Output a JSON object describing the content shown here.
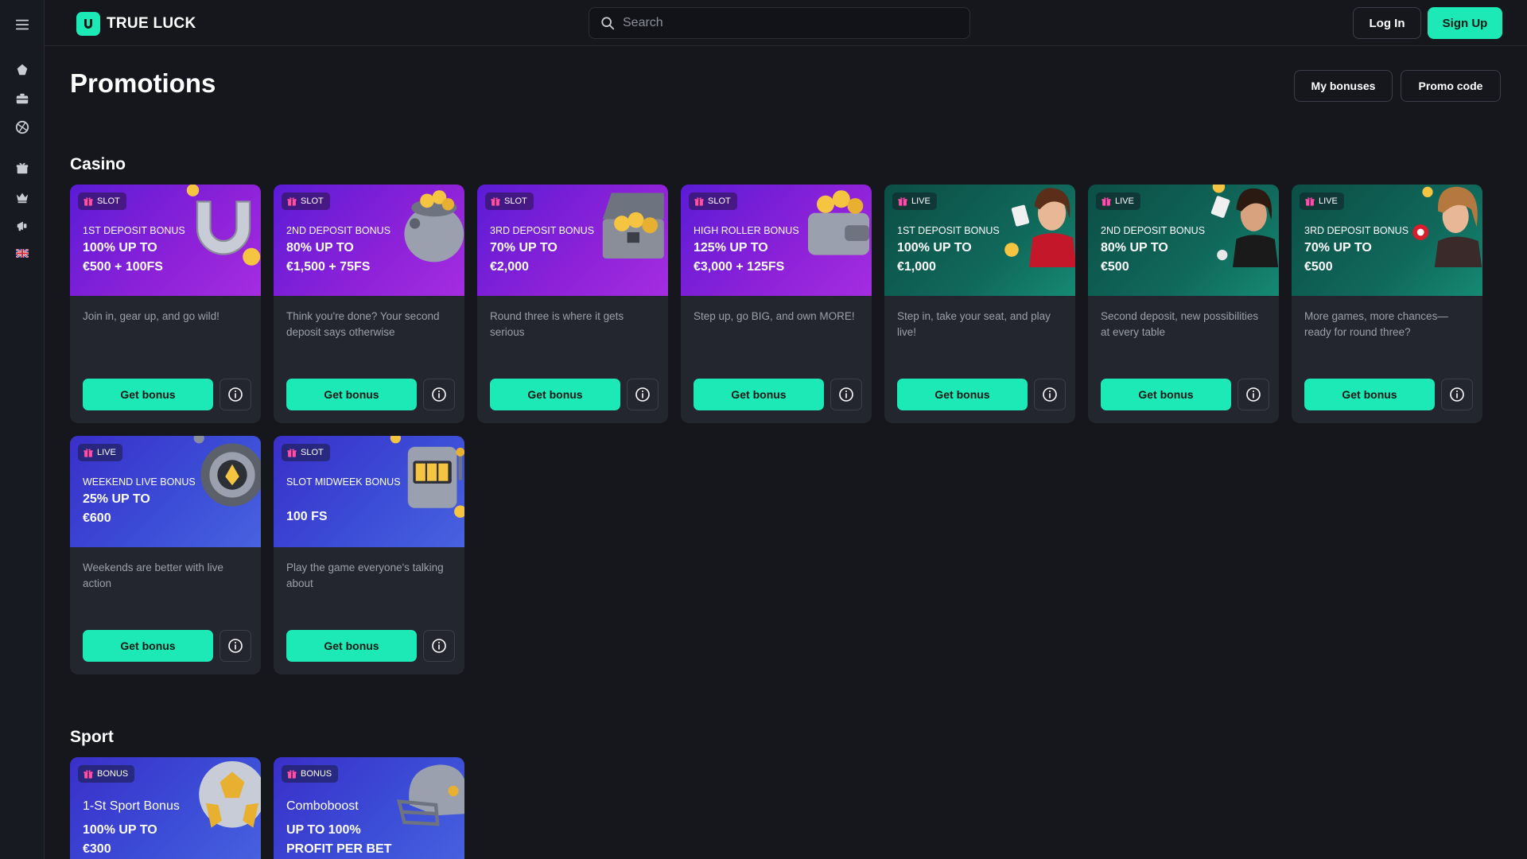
{
  "brand": {
    "name": "TRUE LUCK",
    "accent": "#1de9b6"
  },
  "header": {
    "search_placeholder": "Search",
    "login_label": "Log In",
    "signup_label": "Sign Up"
  },
  "sidebar": {
    "icons": [
      "menu-icon",
      "poker-chip-icon",
      "casino-suitcase-icon",
      "sports-ball-icon",
      "gift-icon",
      "crown-icon",
      "megaphone-icon",
      "uk-flag-icon"
    ]
  },
  "page": {
    "title": "Promotions",
    "my_bonuses_label": "My bonuses",
    "promo_code_label": "Promo code"
  },
  "casino": {
    "title": "Casino",
    "cards": [
      {
        "tag": "SLOT",
        "sub": "1ST DEPOSIT BONUS",
        "line1": "100% UP TO",
        "line2": "€500 + 100FS",
        "desc": "Join in, gear up, and go wild!",
        "button": "Get bonus",
        "theme": "purple",
        "art": "horseshoe-icon"
      },
      {
        "tag": "SLOT",
        "sub": "2ND DEPOSIT BONUS",
        "line1": "80% UP TO",
        "line2": "€1,500 + 75FS",
        "desc": "Think you're done? Your second deposit says otherwise",
        "button": "Get bonus",
        "theme": "purple",
        "art": "coin-pot-icon"
      },
      {
        "tag": "SLOT",
        "sub": "3RD DEPOSIT BONUS",
        "line1": "70% UP TO",
        "line2": "€2,000",
        "desc": "Round three is where it gets serious",
        "button": "Get bonus",
        "theme": "purple",
        "art": "treasure-chest-icon"
      },
      {
        "tag": "SLOT",
        "sub": "HIGH ROLLER BONUS",
        "line1": "125% UP TO",
        "line2": "€3,000 + 125FS",
        "desc": "Step up, go BIG, and own MORE!",
        "button": "Get bonus",
        "theme": "purple",
        "art": "wallet-icon"
      },
      {
        "tag": "LIVE",
        "sub": "1ST DEPOSIT BONUS",
        "line1": "100% UP TO",
        "line2": "€1,000",
        "desc": "Step in, take your seat, and play live!",
        "button": "Get bonus",
        "theme": "green",
        "art": "live-dealer-icon"
      },
      {
        "tag": "LIVE",
        "sub": "2ND DEPOSIT BONUS",
        "line1": "80% UP TO",
        "line2": "€500",
        "desc": "Second deposit, new possibilities at every table",
        "button": "Get bonus",
        "theme": "green",
        "art": "live-dealer-icon"
      },
      {
        "tag": "LIVE",
        "sub": "3RD DEPOSIT BONUS",
        "line1": "70% UP TO",
        "line2": "€500",
        "desc": "More games, more chances—ready for round three?",
        "button": "Get bonus",
        "theme": "green",
        "art": "live-dealer-icon"
      },
      {
        "tag": "LIVE",
        "sub": "WEEKEND LIVE BONUS",
        "line1": "25% UP TO",
        "line2": "€600",
        "desc": "Weekends are better with live action",
        "button": "Get bonus",
        "theme": "blue",
        "art": "poker-chip-icon"
      },
      {
        "tag": "SLOT",
        "sub": "SLOT MIDWEEK BONUS",
        "line1": "100 FS",
        "line2": "",
        "desc": "Play the game everyone's talking about",
        "button": "Get bonus",
        "theme": "blue",
        "art": "slot-machine-icon"
      }
    ]
  },
  "sport": {
    "title": "Sport",
    "cards": [
      {
        "tag": "BONUS",
        "sub": "1-St Sport Bonus",
        "line1": "100% UP TO",
        "line2": "€300",
        "theme": "blue",
        "art": "soccer-ball-icon"
      },
      {
        "tag": "BONUS",
        "sub": "Comboboost",
        "line1": "UP TO 100%",
        "line2": "PROFIT PER BET",
        "theme": "blue",
        "art": "football-helmet-icon"
      }
    ]
  }
}
